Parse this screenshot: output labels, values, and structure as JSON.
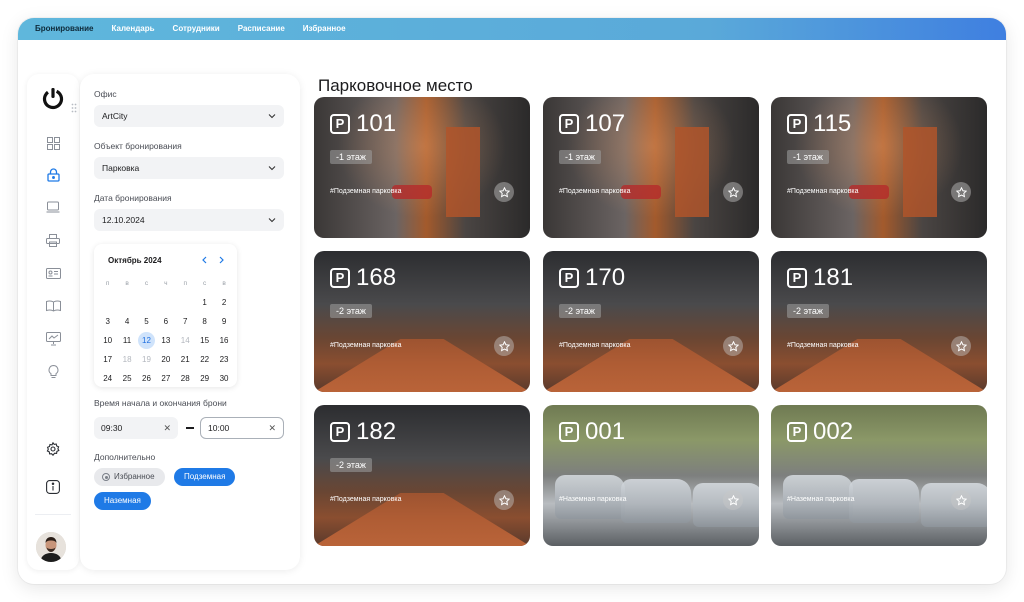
{
  "nav": {
    "tabs": [
      {
        "label": "Бронирование",
        "active": true
      },
      {
        "label": "Календарь",
        "active": false
      },
      {
        "label": "Сотрудники",
        "active": false
      },
      {
        "label": "Расписание",
        "active": false
      },
      {
        "label": "Избранное",
        "active": false
      }
    ]
  },
  "rail": {
    "icons": [
      "grid-icon",
      "lock-icon",
      "laptop-icon",
      "printer-icon",
      "id-card-icon",
      "book-icon",
      "presentation-icon",
      "bulb-icon",
      "settings-icon",
      "info-icon"
    ],
    "active_icon": "lock-icon"
  },
  "filters": {
    "office_label": "Офис",
    "office_value": "ArtCity",
    "object_label": "Объект бронирования",
    "object_value": "Парковка",
    "date_label": "Дата бронирования",
    "date_value": "12.10.2024",
    "calendar": {
      "month": "Октябрь 2024",
      "weekdays": [
        "п",
        "в",
        "с",
        "ч",
        "п",
        "с",
        "в"
      ],
      "weeks": [
        [
          "",
          "",
          "",
          "",
          "",
          "1",
          "2"
        ],
        [
          "3",
          "4",
          "5",
          "6",
          "7",
          "8",
          "9"
        ],
        [
          "10",
          "11",
          "12",
          "13",
          "14",
          "15",
          "16"
        ],
        [
          "17",
          "18",
          "19",
          "20",
          "21",
          "22",
          "23"
        ],
        [
          "24",
          "25",
          "26",
          "27",
          "28",
          "29",
          "30"
        ]
      ],
      "selected": "12",
      "muted": [
        "14",
        "18",
        "19"
      ]
    },
    "time_label": "Время начала и окончания брони",
    "time_start": "09:30",
    "time_end": "10:00",
    "extra_label": "Дополнительно",
    "chips": {
      "favorite": "Избранное",
      "underground": "Подземная",
      "ground": "Наземная"
    }
  },
  "main": {
    "title": "Парковочное место",
    "cards": [
      {
        "number": "101",
        "floor": "-1 этаж",
        "tag": "#Подземная парковка",
        "kind": "under1"
      },
      {
        "number": "107",
        "floor": "-1 этаж",
        "tag": "#Подземная парковка",
        "kind": "under1"
      },
      {
        "number": "115",
        "floor": "-1 этаж",
        "tag": "#Подземная парковка",
        "kind": "under1"
      },
      {
        "number": "168",
        "floor": "-2 этаж",
        "tag": "#Подземная парковка",
        "kind": "under2"
      },
      {
        "number": "170",
        "floor": "-2 этаж",
        "tag": "#Подземная парковка",
        "kind": "under2"
      },
      {
        "number": "181",
        "floor": "-2 этаж",
        "tag": "#Подземная парковка",
        "kind": "under2"
      },
      {
        "number": "182",
        "floor": "-2 этаж",
        "tag": "#Подземная парковка",
        "kind": "under2"
      },
      {
        "number": "001",
        "floor": "",
        "tag": "#Наземная парковка",
        "kind": "ground"
      },
      {
        "number": "002",
        "floor": "",
        "tag": "#Наземная парковка",
        "kind": "ground"
      }
    ]
  },
  "colors": {
    "accent": "#1f7ae6",
    "topbar": "#5fb7dc"
  }
}
